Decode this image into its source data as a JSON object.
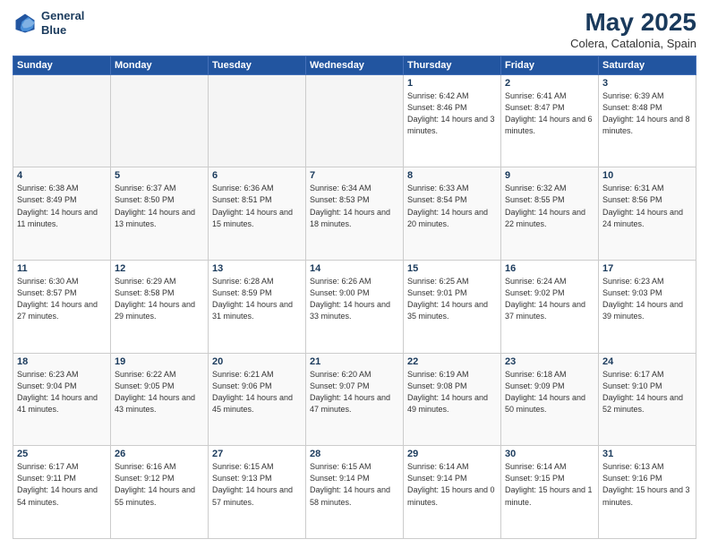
{
  "header": {
    "logo_line1": "General",
    "logo_line2": "Blue",
    "title": "May 2025",
    "subtitle": "Colera, Catalonia, Spain"
  },
  "days_of_week": [
    "Sunday",
    "Monday",
    "Tuesday",
    "Wednesday",
    "Thursday",
    "Friday",
    "Saturday"
  ],
  "weeks": [
    [
      {
        "day": "",
        "info": "",
        "empty": true
      },
      {
        "day": "",
        "info": "",
        "empty": true
      },
      {
        "day": "",
        "info": "",
        "empty": true
      },
      {
        "day": "",
        "info": "",
        "empty": true
      },
      {
        "day": "1",
        "info": "Sunrise: 6:42 AM\nSunset: 8:46 PM\nDaylight: 14 hours\nand 3 minutes.",
        "empty": false
      },
      {
        "day": "2",
        "info": "Sunrise: 6:41 AM\nSunset: 8:47 PM\nDaylight: 14 hours\nand 6 minutes.",
        "empty": false
      },
      {
        "day": "3",
        "info": "Sunrise: 6:39 AM\nSunset: 8:48 PM\nDaylight: 14 hours\nand 8 minutes.",
        "empty": false
      }
    ],
    [
      {
        "day": "4",
        "info": "Sunrise: 6:38 AM\nSunset: 8:49 PM\nDaylight: 14 hours\nand 11 minutes.",
        "empty": false
      },
      {
        "day": "5",
        "info": "Sunrise: 6:37 AM\nSunset: 8:50 PM\nDaylight: 14 hours\nand 13 minutes.",
        "empty": false
      },
      {
        "day": "6",
        "info": "Sunrise: 6:36 AM\nSunset: 8:51 PM\nDaylight: 14 hours\nand 15 minutes.",
        "empty": false
      },
      {
        "day": "7",
        "info": "Sunrise: 6:34 AM\nSunset: 8:53 PM\nDaylight: 14 hours\nand 18 minutes.",
        "empty": false
      },
      {
        "day": "8",
        "info": "Sunrise: 6:33 AM\nSunset: 8:54 PM\nDaylight: 14 hours\nand 20 minutes.",
        "empty": false
      },
      {
        "day": "9",
        "info": "Sunrise: 6:32 AM\nSunset: 8:55 PM\nDaylight: 14 hours\nand 22 minutes.",
        "empty": false
      },
      {
        "day": "10",
        "info": "Sunrise: 6:31 AM\nSunset: 8:56 PM\nDaylight: 14 hours\nand 24 minutes.",
        "empty": false
      }
    ],
    [
      {
        "day": "11",
        "info": "Sunrise: 6:30 AM\nSunset: 8:57 PM\nDaylight: 14 hours\nand 27 minutes.",
        "empty": false
      },
      {
        "day": "12",
        "info": "Sunrise: 6:29 AM\nSunset: 8:58 PM\nDaylight: 14 hours\nand 29 minutes.",
        "empty": false
      },
      {
        "day": "13",
        "info": "Sunrise: 6:28 AM\nSunset: 8:59 PM\nDaylight: 14 hours\nand 31 minutes.",
        "empty": false
      },
      {
        "day": "14",
        "info": "Sunrise: 6:26 AM\nSunset: 9:00 PM\nDaylight: 14 hours\nand 33 minutes.",
        "empty": false
      },
      {
        "day": "15",
        "info": "Sunrise: 6:25 AM\nSunset: 9:01 PM\nDaylight: 14 hours\nand 35 minutes.",
        "empty": false
      },
      {
        "day": "16",
        "info": "Sunrise: 6:24 AM\nSunset: 9:02 PM\nDaylight: 14 hours\nand 37 minutes.",
        "empty": false
      },
      {
        "day": "17",
        "info": "Sunrise: 6:23 AM\nSunset: 9:03 PM\nDaylight: 14 hours\nand 39 minutes.",
        "empty": false
      }
    ],
    [
      {
        "day": "18",
        "info": "Sunrise: 6:23 AM\nSunset: 9:04 PM\nDaylight: 14 hours\nand 41 minutes.",
        "empty": false
      },
      {
        "day": "19",
        "info": "Sunrise: 6:22 AM\nSunset: 9:05 PM\nDaylight: 14 hours\nand 43 minutes.",
        "empty": false
      },
      {
        "day": "20",
        "info": "Sunrise: 6:21 AM\nSunset: 9:06 PM\nDaylight: 14 hours\nand 45 minutes.",
        "empty": false
      },
      {
        "day": "21",
        "info": "Sunrise: 6:20 AM\nSunset: 9:07 PM\nDaylight: 14 hours\nand 47 minutes.",
        "empty": false
      },
      {
        "day": "22",
        "info": "Sunrise: 6:19 AM\nSunset: 9:08 PM\nDaylight: 14 hours\nand 49 minutes.",
        "empty": false
      },
      {
        "day": "23",
        "info": "Sunrise: 6:18 AM\nSunset: 9:09 PM\nDaylight: 14 hours\nand 50 minutes.",
        "empty": false
      },
      {
        "day": "24",
        "info": "Sunrise: 6:17 AM\nSunset: 9:10 PM\nDaylight: 14 hours\nand 52 minutes.",
        "empty": false
      }
    ],
    [
      {
        "day": "25",
        "info": "Sunrise: 6:17 AM\nSunset: 9:11 PM\nDaylight: 14 hours\nand 54 minutes.",
        "empty": false
      },
      {
        "day": "26",
        "info": "Sunrise: 6:16 AM\nSunset: 9:12 PM\nDaylight: 14 hours\nand 55 minutes.",
        "empty": false
      },
      {
        "day": "27",
        "info": "Sunrise: 6:15 AM\nSunset: 9:13 PM\nDaylight: 14 hours\nand 57 minutes.",
        "empty": false
      },
      {
        "day": "28",
        "info": "Sunrise: 6:15 AM\nSunset: 9:14 PM\nDaylight: 14 hours\nand 58 minutes.",
        "empty": false
      },
      {
        "day": "29",
        "info": "Sunrise: 6:14 AM\nSunset: 9:14 PM\nDaylight: 15 hours\nand 0 minutes.",
        "empty": false
      },
      {
        "day": "30",
        "info": "Sunrise: 6:14 AM\nSunset: 9:15 PM\nDaylight: 15 hours\nand 1 minute.",
        "empty": false
      },
      {
        "day": "31",
        "info": "Sunrise: 6:13 AM\nSunset: 9:16 PM\nDaylight: 15 hours\nand 3 minutes.",
        "empty": false
      }
    ]
  ]
}
